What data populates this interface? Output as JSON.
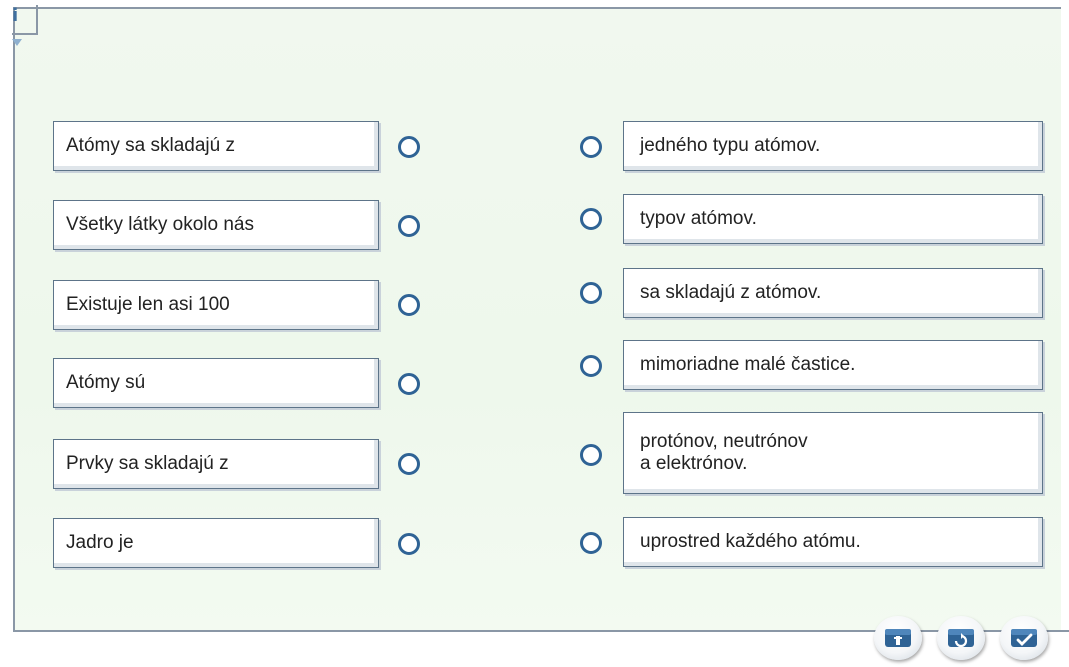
{
  "info_icon_label": "i",
  "left_items": [
    {
      "label": "Atómy sa skladajú z"
    },
    {
      "label": "Všetky látky okolo nás"
    },
    {
      "label": "Existuje len asi 100"
    },
    {
      "label": "Atómy sú"
    },
    {
      "label": "Prvky sa skladajú z"
    },
    {
      "label": "Jadro je"
    }
  ],
  "right_items": [
    {
      "label": "jedného typu atómov."
    },
    {
      "label": "typov atómov."
    },
    {
      "label": "sa skladajú z atómov."
    },
    {
      "label": "mimoriadne malé častice."
    },
    {
      "label": "protónov, neutrónov\na elektrónov."
    },
    {
      "label": "uprostred každého atómu."
    }
  ],
  "toolbar": {
    "icons": [
      "hint-icon",
      "reset-icon",
      "check-icon"
    ]
  },
  "colors": {
    "accent": "#2f6395",
    "panel_bg": "#eef8ec",
    "border": "#8a97a6"
  }
}
